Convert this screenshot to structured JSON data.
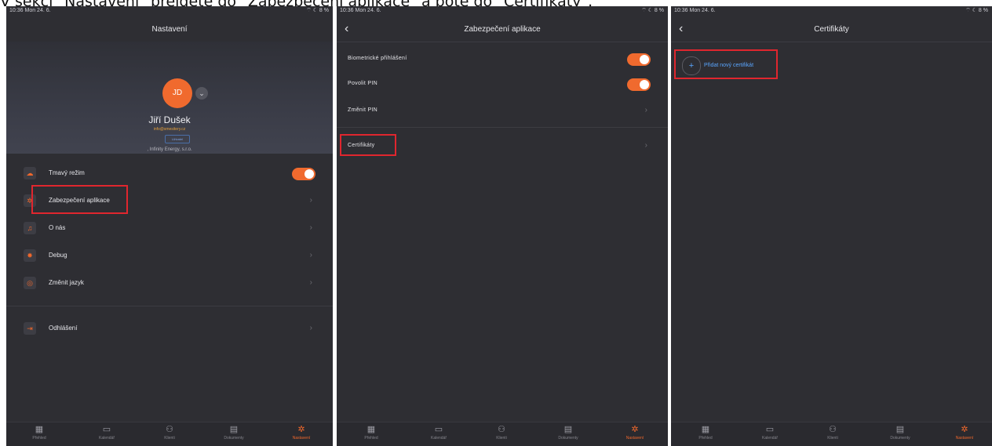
{
  "caption": "V sekci \"Nastavení\" přejděte do \"Zabezpečení aplikace\" a poté do \"Certifikáty\".",
  "status": {
    "time": "10:36",
    "date": "Mon 24. 6.",
    "right": "⌔ ☾ 8 %"
  },
  "tabs": [
    {
      "icon": "dashboard-icon",
      "glyph": "▦",
      "label": "Přehled"
    },
    {
      "icon": "calendar-icon",
      "glyph": "▭",
      "label": "Kalendář"
    },
    {
      "icon": "clients-icon",
      "glyph": "⚇",
      "label": "Klienti"
    },
    {
      "icon": "documents-icon",
      "glyph": "▤",
      "label": "Dokumenty"
    },
    {
      "icon": "settings-icon",
      "glyph": "✲",
      "label": "Nastavení"
    }
  ],
  "screen1": {
    "title": "Nastavení",
    "avatar_initials": "JD",
    "user_name": "Jiří Dušek",
    "user_email": "info@smesitery.cz",
    "user_badge": "Uživatel",
    "company": ", Infinity Energy, s.r.o.",
    "items": [
      {
        "label": "Tmavý režim",
        "icon": "cloud-icon",
        "glyph": "☁",
        "type": "toggle",
        "on": true
      },
      {
        "label": "Zabezpečení aplikace",
        "icon": "gear-icon",
        "glyph": "✲",
        "type": "chevron"
      },
      {
        "label": "O nás",
        "icon": "headphones-icon",
        "glyph": "♫",
        "type": "chevron"
      },
      {
        "label": "Debug",
        "icon": "bug-icon",
        "glyph": "✸",
        "type": "chevron"
      },
      {
        "label": "Změnit jazyk",
        "icon": "globe-icon",
        "glyph": "◎",
        "type": "chevron"
      }
    ],
    "logout_label": "Odhlášení",
    "logout_glyph": "⇥"
  },
  "screen2": {
    "title": "Zabezpečení aplikace",
    "items": [
      {
        "label": "Biometrické přihlášení",
        "type": "toggle",
        "on": true
      },
      {
        "label": "Povolit PIN",
        "type": "toggle",
        "on": true
      },
      {
        "label": "Změnit PIN",
        "type": "chevron"
      }
    ],
    "certificates_label": "Certifikáty"
  },
  "screen3": {
    "title": "Certifikáty",
    "add_label": "Přidat nový certifikát"
  },
  "colors": {
    "accent": "#f06a2e",
    "highlight": "#e0262e",
    "link": "#5aa6ff",
    "background": "#2e2e33"
  }
}
